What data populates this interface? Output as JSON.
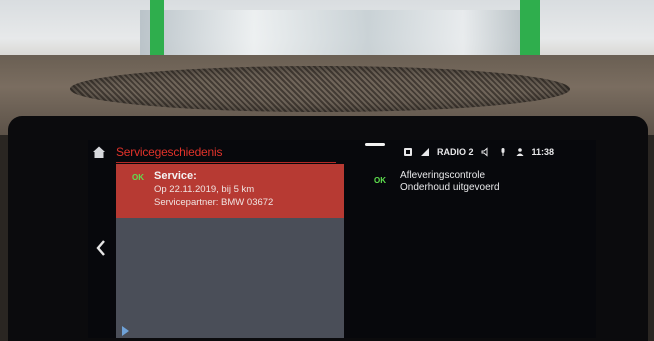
{
  "screen": {
    "title": "Servicegeschiedenis",
    "status_bar": {
      "radio": "RADIO 2",
      "time": "11:38",
      "icons": [
        "phone-icon",
        "signal-icon",
        "speaker-icon",
        "microphone-icon",
        "person-icon"
      ]
    }
  },
  "service_list": {
    "items": [
      {
        "status": "OK",
        "title": "Service:",
        "line1": "Op 22.11.2019, bij 5 km",
        "line2": "Servicepartner: BMW 03672"
      }
    ]
  },
  "detail": {
    "status": "OK",
    "title": "Afleveringscontrole",
    "subtitle": "Onderhoud uitgevoerd"
  },
  "colors": {
    "accent_red": "#e0322a",
    "selected_item": "#b73a33",
    "ok_green": "#5ee04e"
  }
}
